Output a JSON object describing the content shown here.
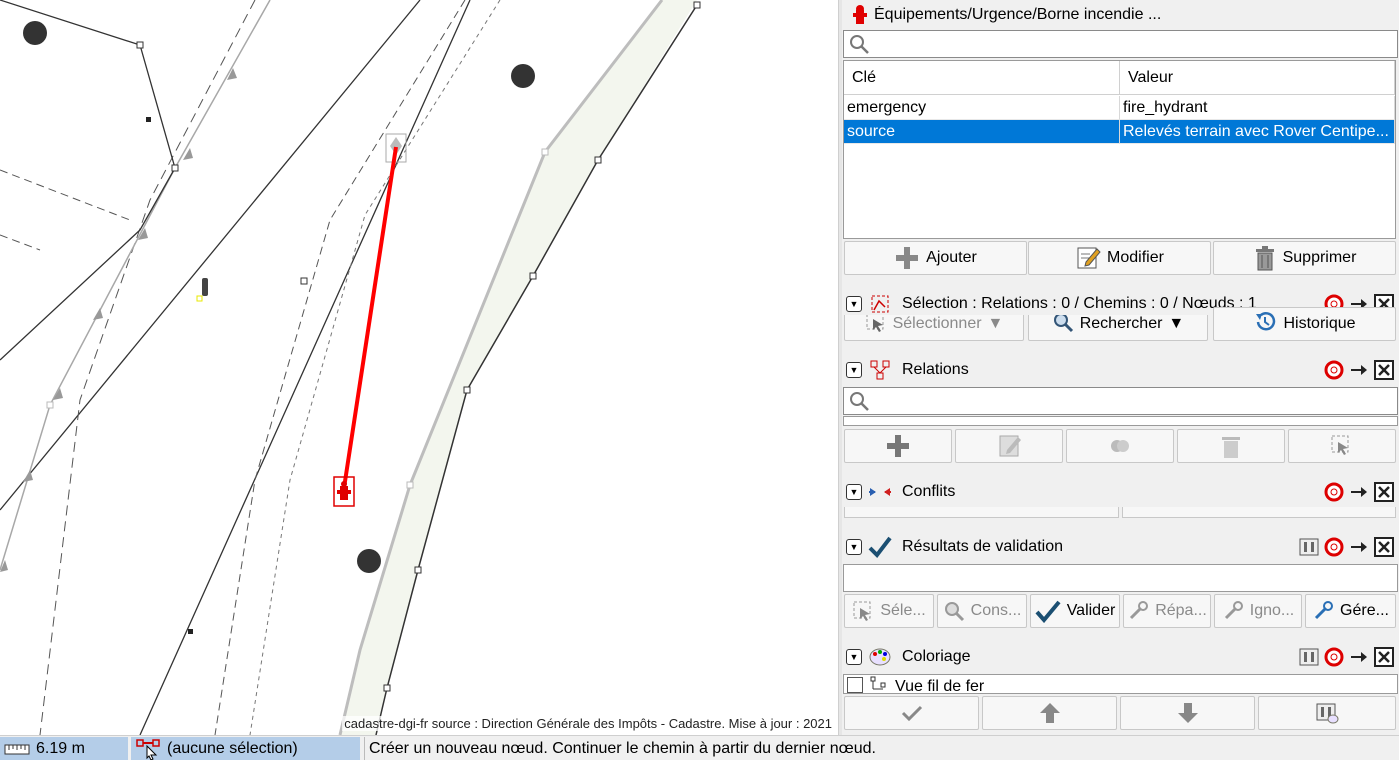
{
  "map": {
    "attribution": "cadastre-dgi-fr source : Direction Générale des Impôts - Cadastre. Mise à jour : 2021"
  },
  "tags_panel": {
    "title": "Équipements/Urgence/Borne incendie ...",
    "search_placeholder": "",
    "columns": [
      "Clé",
      "Valeur"
    ],
    "rows": [
      {
        "key": "emergency",
        "value": "fire_hydrant",
        "selected": false
      },
      {
        "key": "source",
        "value": "Relevés terrain avec Rover Centipe...",
        "selected": true
      }
    ],
    "buttons": {
      "add": "Ajouter",
      "edit": "Modifier",
      "delete": "Supprimer"
    }
  },
  "selection_panel": {
    "title": "Sélection : Relations : 0 / Chemins : 0 / Nœuds : 1",
    "buttons": {
      "select": "Sélectionner",
      "search": "Rechercher",
      "history": "Historique"
    }
  },
  "relations_panel": {
    "title": "Relations"
  },
  "conflicts_panel": {
    "title": "Conflits"
  },
  "validation_panel": {
    "title": "Résultats de validation",
    "buttons": {
      "select": "Séle...",
      "inspect": "Cons...",
      "validate": "Valider",
      "fix": "Répa...",
      "ignore": "Igno...",
      "manage": "Gére..."
    }
  },
  "colors_panel": {
    "title": "Coloriage",
    "items": [
      {
        "label": "Vue fil de fer",
        "checked": false
      }
    ]
  },
  "statusbar": {
    "distance": "6.19 m",
    "selection": "(aucune sélection)",
    "help": "Créer un nouveau nœud. Continuer le chemin à partir du dernier nœud."
  },
  "colors": {
    "accent_selection": "#0078d7",
    "draw_line": "#ff0000",
    "hydrant": "#e00000"
  },
  "icons": {
    "tags_header": "fire-hydrant-icon",
    "add": "plus-icon",
    "edit": "pencil-icon",
    "delete": "trash-icon",
    "history": "history-icon",
    "validate": "checkmark-icon"
  }
}
